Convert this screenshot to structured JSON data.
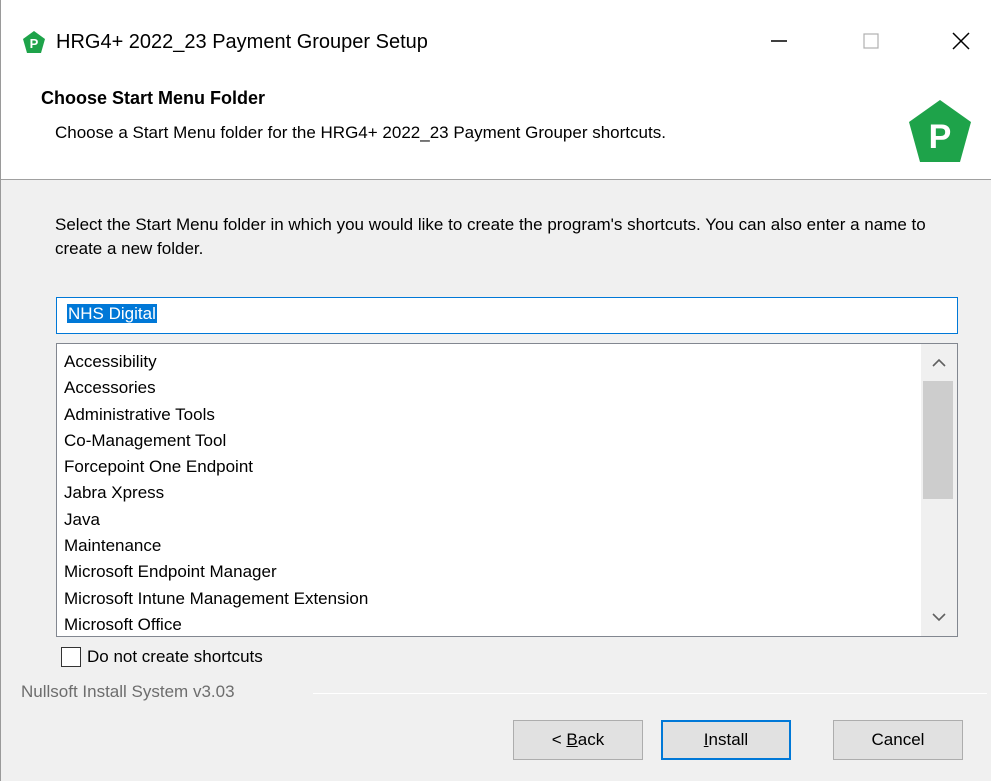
{
  "window": {
    "title": "HRG4+ 2022_23 Payment Grouper Setup"
  },
  "header": {
    "title": "Choose Start Menu Folder",
    "subtitle": "Choose a Start Menu folder for the HRG4+ 2022_23 Payment Grouper shortcuts.",
    "logo_letter": "P"
  },
  "instructions": "Select the Start Menu folder in which you would like to create the program's shortcuts. You can also enter a name to create a new folder.",
  "folder_input": {
    "value": "NHS Digital"
  },
  "folder_list": [
    "Accessibility",
    "Accessories",
    "Administrative Tools",
    "Co-Management Tool",
    "Forcepoint One Endpoint",
    "Jabra Xpress",
    "Java",
    "Maintenance",
    "Microsoft Endpoint Manager",
    "Microsoft Intune Management Extension",
    "Microsoft Office"
  ],
  "no_shortcuts_checkbox": {
    "label": "Do not create shortcuts",
    "checked": false
  },
  "branding": "Nullsoft Install System v3.03",
  "buttons": {
    "back_hotkey": "B",
    "back_rest": "ack",
    "back_prefix": "< ",
    "install_hotkey": "I",
    "install_rest": "nstall",
    "cancel": "Cancel"
  },
  "colors": {
    "accent": "#0078d7",
    "logo_green": "#1ea34a"
  },
  "icons": {
    "app": "pentagon-p-icon",
    "minimize": "minimize-icon",
    "maximize": "maximize-icon",
    "close": "close-icon",
    "scroll_up": "chevron-up-icon",
    "scroll_down": "chevron-down-icon"
  }
}
